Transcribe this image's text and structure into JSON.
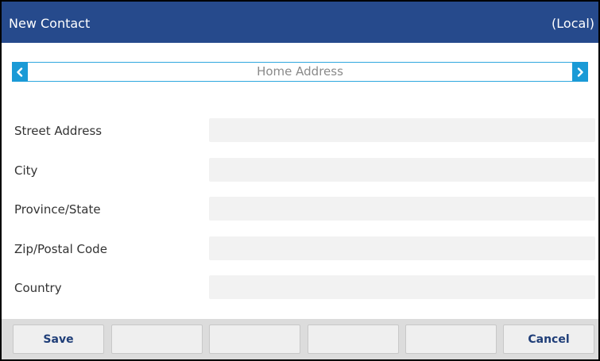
{
  "header": {
    "title": "New Contact",
    "scope": "(Local)"
  },
  "tabnav": {
    "current_tab": "Home Address",
    "prev_icon": "chevron-left-icon",
    "next_icon": "chevron-right-icon"
  },
  "form": {
    "fields": [
      {
        "label": "Street Address",
        "value": ""
      },
      {
        "label": "City",
        "value": ""
      },
      {
        "label": "Province/State",
        "value": ""
      },
      {
        "label": "Zip/Postal Code",
        "value": ""
      },
      {
        "label": "Country",
        "value": ""
      }
    ]
  },
  "softkeys": [
    {
      "label": "Save"
    },
    {
      "label": ""
    },
    {
      "label": ""
    },
    {
      "label": ""
    },
    {
      "label": ""
    },
    {
      "label": "Cancel"
    }
  ],
  "colors": {
    "header_bg": "#264a8c",
    "accent_blue": "#1a9ad6",
    "softkey_text": "#1f3e78"
  }
}
